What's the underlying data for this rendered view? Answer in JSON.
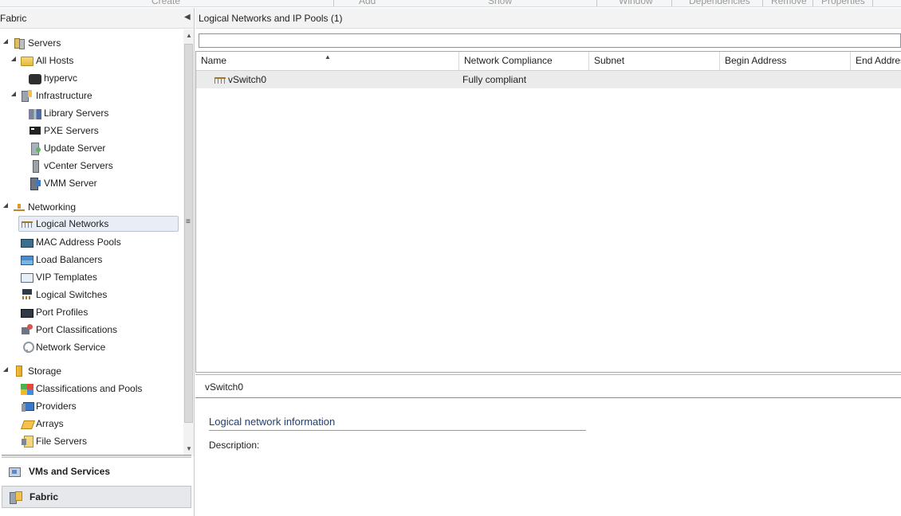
{
  "ribbon": {
    "groups": [
      "Create",
      "Add",
      "Show",
      "Window",
      "Dependencies",
      "Remove",
      "Properties"
    ]
  },
  "navigation": {
    "title": "Fabric",
    "tree": [
      {
        "label": "Servers",
        "icon": "servers-icon"
      },
      {
        "label": "All Hosts",
        "icon": "folder-icon"
      },
      {
        "label": "hypervc",
        "icon": "host-icon"
      },
      {
        "label": "Infrastructure",
        "icon": "infrastructure-icon"
      },
      {
        "label": "Library Servers",
        "icon": "library-server-icon"
      },
      {
        "label": "PXE Servers",
        "icon": "pxe-server-icon"
      },
      {
        "label": "Update Server",
        "icon": "update-server-icon"
      },
      {
        "label": "vCenter Servers",
        "icon": "vcenter-server-icon"
      },
      {
        "label": "VMM Server",
        "icon": "vmm-server-icon"
      },
      {
        "label": "Networking",
        "icon": "networking-icon"
      },
      {
        "label": "Logical Networks",
        "icon": "logical-network-icon"
      },
      {
        "label": "MAC Address Pools",
        "icon": "mac-pool-icon"
      },
      {
        "label": "Load Balancers",
        "icon": "load-balancer-icon"
      },
      {
        "label": "VIP Templates",
        "icon": "vip-template-icon"
      },
      {
        "label": "Logical Switches",
        "icon": "logical-switch-icon"
      },
      {
        "label": "Port Profiles",
        "icon": "port-profile-icon"
      },
      {
        "label": "Port Classifications",
        "icon": "port-classification-icon"
      },
      {
        "label": "Network Service",
        "icon": "network-service-icon"
      },
      {
        "label": "Storage",
        "icon": "storage-icon"
      },
      {
        "label": "Classifications and Pools",
        "icon": "classification-icon"
      },
      {
        "label": "Providers",
        "icon": "provider-icon"
      },
      {
        "label": "Arrays",
        "icon": "array-icon"
      },
      {
        "label": "File Servers",
        "icon": "file-server-icon"
      }
    ],
    "selected": "Logical Networks",
    "workspaces": [
      {
        "label": "VMs and Services",
        "icon": "vms-services-icon"
      },
      {
        "label": "Fabric",
        "icon": "fabric-icon"
      }
    ]
  },
  "main": {
    "title": "Logical Networks and IP Pools (1)",
    "search_value": "",
    "columns": [
      "Name",
      "Network Compliance",
      "Subnet",
      "Begin Address",
      "End Address"
    ],
    "rows": [
      {
        "name": "vSwitch0",
        "compliance": "Fully compliant",
        "subnet": "",
        "begin": "",
        "end": ""
      }
    ]
  },
  "details": {
    "title": "vSwitch0",
    "section_title": "Logical network information",
    "description_label": "Description:"
  }
}
